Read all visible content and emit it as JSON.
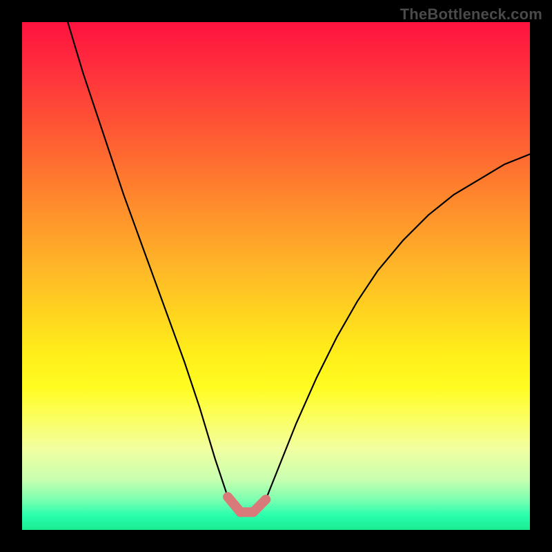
{
  "watermark": "TheBottleneck.com",
  "chart_data": {
    "type": "line",
    "title": "",
    "xlabel": "",
    "ylabel": "",
    "xlim": [
      0,
      100
    ],
    "ylim": [
      0,
      100
    ],
    "series": [
      {
        "name": "curve",
        "x": [
          9,
          12,
          16,
          20,
          24,
          28,
          32,
          35,
          38,
          40.5,
          43,
          45.5,
          48,
          50,
          54,
          58,
          62,
          66,
          70,
          75,
          80,
          85,
          90,
          95,
          100
        ],
        "values": [
          100,
          90,
          78,
          66,
          55,
          44,
          33,
          24,
          14,
          6.5,
          3.5,
          3.5,
          6,
          11,
          21,
          30,
          38,
          45,
          51,
          57,
          62,
          66,
          69,
          72,
          74
        ]
      }
    ],
    "markers": [
      {
        "name": "left-foot",
        "x": [
          40.5,
          43
        ],
        "y": [
          6.5,
          3.5
        ],
        "color": "#d87a7a"
      },
      {
        "name": "flat",
        "x": [
          43,
          45.5
        ],
        "y": [
          3.5,
          3.5
        ],
        "color": "#d87a7a"
      },
      {
        "name": "right-foot",
        "x": [
          45.5,
          48
        ],
        "y": [
          3.5,
          6
        ],
        "color": "#d87a7a"
      }
    ],
    "gradient_stops": [
      {
        "pct": 0,
        "color": "#ff123f"
      },
      {
        "pct": 22,
        "color": "#ff5a33"
      },
      {
        "pct": 48,
        "color": "#ffb528"
      },
      {
        "pct": 72,
        "color": "#fffc22"
      },
      {
        "pct": 90,
        "color": "#c9ffb0"
      },
      {
        "pct": 100,
        "color": "#19ec90"
      }
    ]
  }
}
